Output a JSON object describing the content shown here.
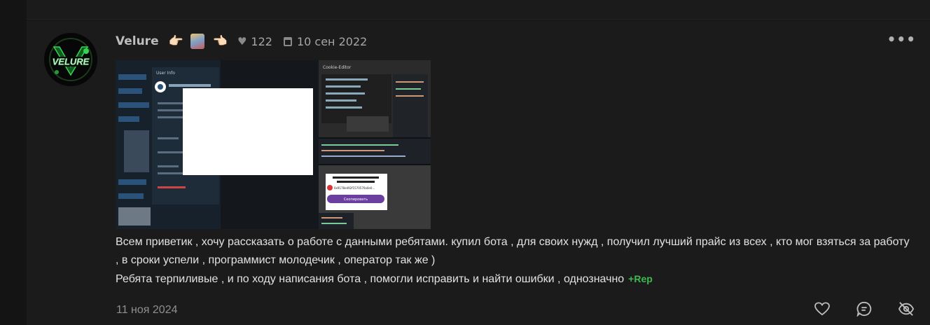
{
  "post": {
    "author": "Velure",
    "emoji_left": "👉🏻",
    "emoji_right": "👈🏻",
    "likes": "122",
    "date": "10 сен 2022",
    "more": "•••",
    "avatar_text": "VELURE",
    "message_line1": "Всем приветик , хочу рассказать о работе с данными ребятами. купил бота , для своих нужд , получил лучший прайс из всех , кто мог взяться за работу , в сроки успели , программист молодечик , оператор так же )",
    "message_line2": "Ребята терпиливые , и по ходу написания бота , помогли исправить и найти ошибки , однозначно",
    "rep_label": "+Rep",
    "posted_date": "11 ноя 2024"
  },
  "screenshot": {
    "window_title": "User Info",
    "editor_title": "Cookie-Editor",
    "modal_address": "0x9178e492f1570570a0e0...",
    "purple_button": "Скопировать"
  },
  "colors": {
    "accent_green": "#3fb950",
    "avatar_green": "#39d353"
  },
  "icons": [
    "heart-icon",
    "calendar-icon",
    "more-icon",
    "like-heart-icon",
    "comment-icon",
    "hide-icon"
  ]
}
